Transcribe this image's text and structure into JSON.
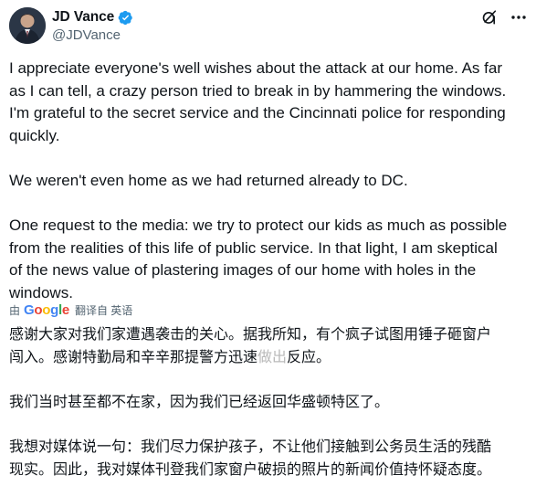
{
  "author": {
    "display_name": "JD Vance",
    "handle": "@JDVance"
  },
  "icons": {
    "verified": "verified-badge-icon",
    "grok": "grok-icon",
    "more": "more-icon"
  },
  "colors": {
    "verified": "#1d9bf0",
    "secondary_text": "#536471",
    "primary_text": "#0f1419"
  },
  "post": {
    "paragraphs": [
      [
        "I appreciate everyone's well wishes about the attack at our home. As far",
        "as I can tell, a crazy person tried to break in by hammering the windows.",
        "I'm grateful to the secret service and the Cincinnati police for responding",
        "quickly."
      ],
      [
        "We weren't even home as we had returned already to DC."
      ],
      [
        "One request to the media: we try to protect our kids as much as possible",
        "from the realities of this life of public service. In that light, I am skeptical",
        "of the news value of plastering images of our home with holes in the",
        "windows."
      ]
    ]
  },
  "translation_bar": {
    "by": "由",
    "provider": "Google",
    "action": "翻译自 英语"
  },
  "translation": {
    "p1": {
      "line1": "感谢大家对我们家遭遇袭击的关心。据我所知，有个疯子试图用锤子砸窗户",
      "line2_a": "闯入。感谢特勤局和辛辛那提警方迅速",
      "line2_blur": "做出",
      "line2_b": "反应。"
    },
    "p2": "我们当时甚至都不在家，因为我们已经返回华盛顿特区了。",
    "p3": {
      "line1": "我想对媒体说一句：我们尽力保护孩子，不让他们接触到公务员生活的残酷",
      "line2": "现实。因此，我对媒体刊登我们家窗户破损的照片的新闻价值持怀疑态度。"
    }
  }
}
